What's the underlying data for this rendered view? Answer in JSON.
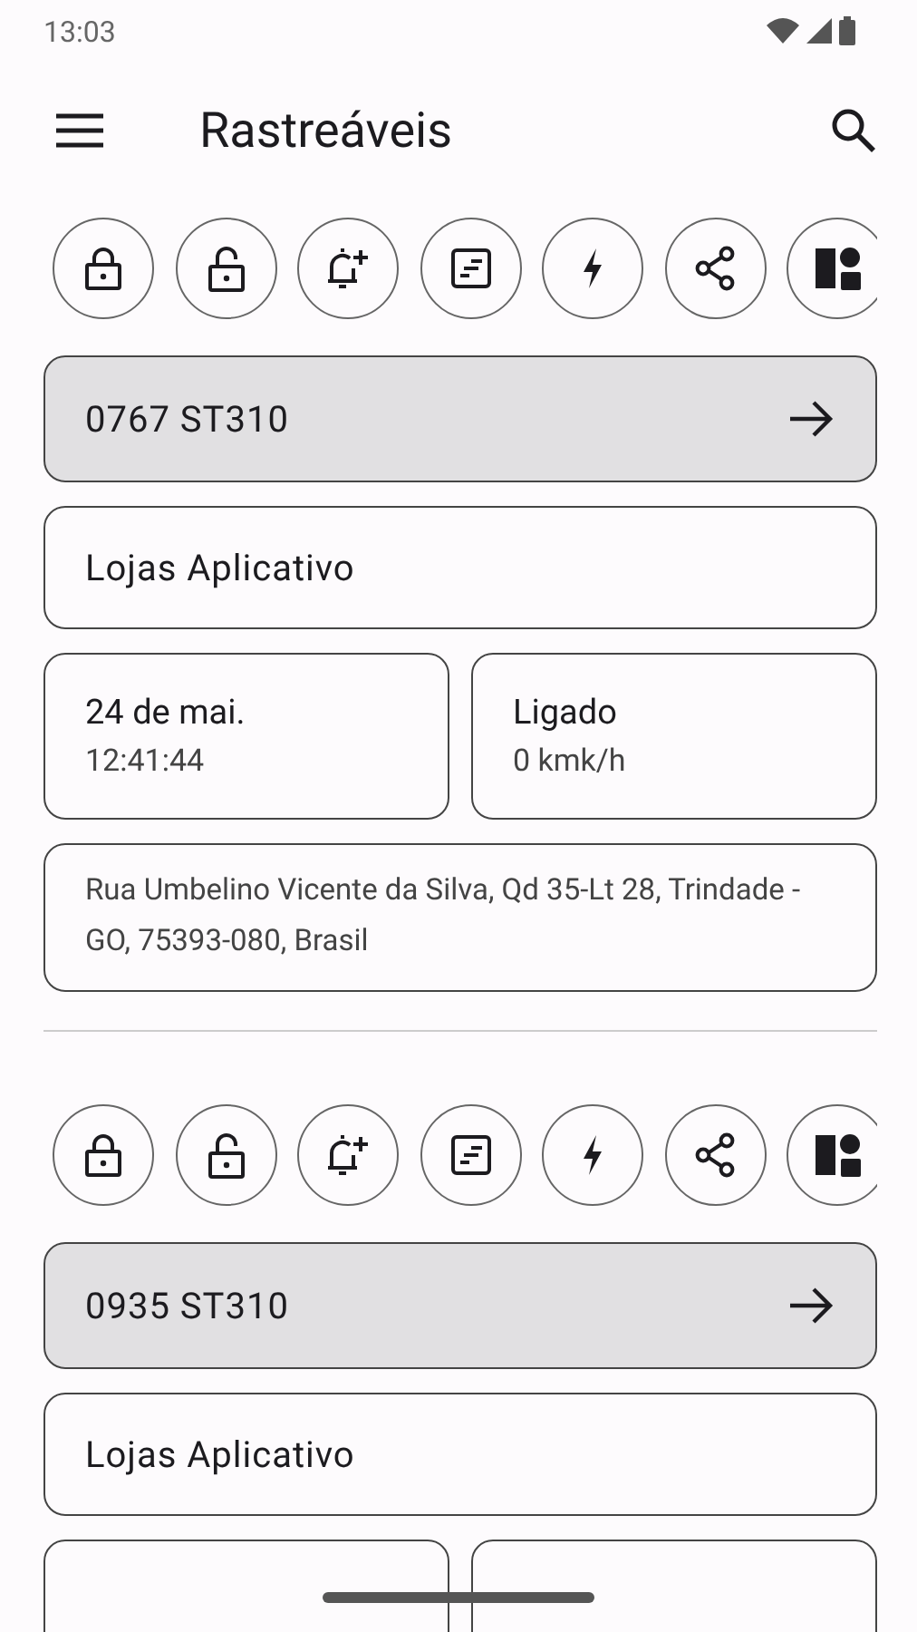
{
  "status_bar": {
    "time": "13:03"
  },
  "app_bar": {
    "title": "Rastreáveis"
  },
  "trackers": [
    {
      "actions": [
        {
          "kind": "lock"
        },
        {
          "kind": "unlock"
        },
        {
          "kind": "alarm-add"
        },
        {
          "kind": "note"
        },
        {
          "kind": "bolt"
        },
        {
          "kind": "share"
        },
        {
          "kind": "shapes"
        }
      ],
      "id": "0767 ST310",
      "group": "Lojas Aplicativo",
      "date": "24 de mai.",
      "time": "12:41:44",
      "ignition": "Ligado",
      "speed": "0 kmk/h",
      "address": "Rua Umbelino Vicente da Silva, Qd 35-Lt 28, Trindade - GO, 75393-080, Brasil"
    },
    {
      "actions": [
        {
          "kind": "lock"
        },
        {
          "kind": "unlock"
        },
        {
          "kind": "alarm-add"
        },
        {
          "kind": "note"
        },
        {
          "kind": "bolt"
        },
        {
          "kind": "share"
        },
        {
          "kind": "shapes"
        }
      ],
      "id": "0935 ST310",
      "group": "Lojas Aplicativo"
    }
  ]
}
